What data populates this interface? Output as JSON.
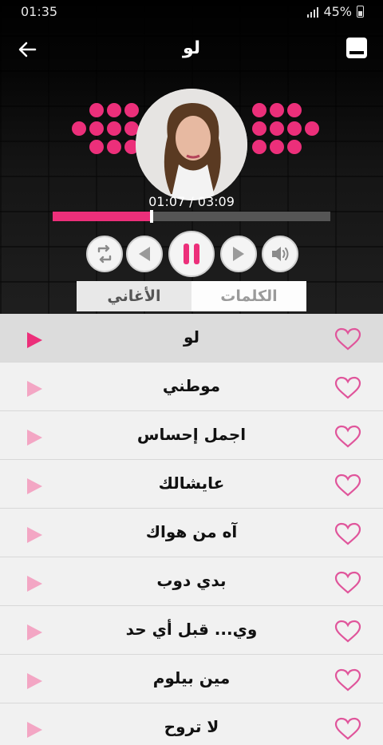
{
  "status": {
    "time": "01:35",
    "battery": "45%"
  },
  "header": {
    "title": "لو"
  },
  "player": {
    "elapsed": "01:07",
    "duration": "03:09",
    "time_display": "01:07 / 03:09",
    "progress_fraction": 0.355,
    "state": "playing",
    "accent": "#ec2f7a"
  },
  "tabs": [
    {
      "label": "الأغاني",
      "selected": true
    },
    {
      "label": "الكلمات",
      "selected": false
    }
  ],
  "songs": [
    {
      "title": "لو",
      "active": true
    },
    {
      "title": "موطني"
    },
    {
      "title": "اجمل إحساس"
    },
    {
      "title": "عايشالك"
    },
    {
      "title": "آه من هواك"
    },
    {
      "title": "بدي دوب"
    },
    {
      "title": "وي... قبل أي حد"
    },
    {
      "title": "مين بيلوم"
    },
    {
      "title": "لا تروح"
    }
  ],
  "icons": {
    "back": "arrow-left-icon",
    "menu": "menu-icon",
    "repeat": "repeat-icon",
    "prev": "previous-icon",
    "pause": "pause-icon",
    "next": "next-icon",
    "volume": "volume-icon",
    "play": "play-icon",
    "favorite": "heart-icon"
  }
}
